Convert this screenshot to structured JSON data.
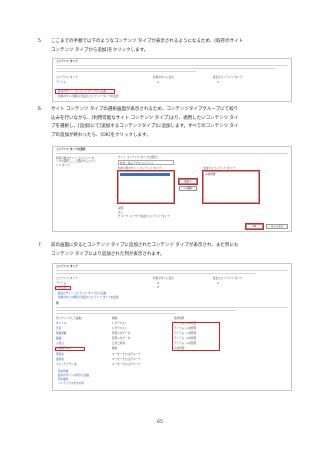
{
  "steps": [
    {
      "num": "5.",
      "lines": [
        "ここまでの手順で以下のようなコンテンツ タイプが表示されるようになるため、[既存のサイト",
        "コンテンツ タイプから追加]をクリックします。"
      ]
    },
    {
      "num": "6.",
      "lines": [
        "サイト コンテンツ タイプの選択画面が表示されるため、コンテンツタイプグループにて絞り",
        "込みを行いながら、[利用可能なサイト コンテンツ タイプ]より、適用したいコンテンツ タイ",
        "プを選択し、[追加]にて[追加するコンテンツタイプ]に追加します。すべてのコンテンツ タイ",
        "プの追加が終わったら、[OK]をクリックします。"
      ]
    },
    {
      "num": "7.",
      "lines": [
        "前の画面に戻るとコンテンツ タイプに追加されたコンテンツ タイプが表示され、また列にも",
        "コンテンツ タイプにより追加された列が表示されます。"
      ]
    }
  ],
  "shot1": {
    "title": "コンテンツ タイプ",
    "cols": [
      "コンテンツ タイプ",
      "新規ボタンに表示",
      "既定のコンテンツ タイプ"
    ],
    "row": [
      "アイテム",
      "✔",
      "✔"
    ],
    "link1": "既存のサイト コンテンツ タイプから追加",
    "link2": "新規ボタンの順序と既定のコンテンツ タイプの変更"
  },
  "shot2": {
    "title": "コンテンツ タイプの選択",
    "left_label": "利用可能なサイト コンテンツ タイプの選択 ここで選択するコンテンツ タイプ",
    "group_label": "サイト コンテンツ タイプの選択元:",
    "group_value": "社内 - 電子アクスコンテンツ",
    "available_label": "利用可能なサイト コンテンツ タイプ:",
    "added_label": "追加するコンテンツ タイプ:",
    "add_button": "追加 >",
    "remove_button": "< 削除",
    "desc_label": "説明:",
    "desc_value": "なし",
    "group_footer": "グループ: ユーザー指定のコンテンツ タイプ",
    "ok": "OK",
    "cancel": "キャンセル"
  },
  "shot3": {
    "title": "コンテンツ タイプ",
    "cols": [
      "コンテンツ タイプ",
      "新規ボタンに表示",
      "既定のコンテンツ タイプ"
    ],
    "types": [
      [
        "アイテム",
        "✔",
        "✔"
      ],
      [
        "人材管理",
        "✔",
        ""
      ]
    ],
    "link1": "既存のサイト コンテンツ タイプから追加",
    "link2": "新規ボタンの順序と既定のコンテンツ タイプの変更",
    "cols_title": "列",
    "col_headers": [
      "列 (クリックして編集)",
      "種類",
      "使用場所"
    ],
    "columns": [
      [
        "タイトル",
        "1 行テキスト",
        "アイテム, 人材管理"
      ],
      [
        "氏名",
        "1 行テキスト",
        "アイテム, 人材管理"
      ],
      [
        "所属部署",
        "管理メタデータ",
        "アイテム, 人材管理"
      ],
      [
        "役職",
        "管理メタデータ",
        "アイテム, 人材管理"
      ],
      [
        "入社日",
        "日付と時刻",
        "アイテム, 人材管理"
      ],
      [
        "社員番号(ID)",
        "数値",
        "人材管理"
      ],
      [
        "登録者",
        "ユーザーまたはグループ",
        ""
      ],
      [
        "更新者",
        "ユーザーまたはグループ",
        ""
      ],
      [
        "チェックアウト先",
        "ユーザーまたはグループ",
        ""
      ]
    ],
    "footer_links": [
      "列の作成",
      "既存のサイトの列から追加",
      "列の順序",
      "インデックス付きの列"
    ]
  },
  "page_number": "65"
}
